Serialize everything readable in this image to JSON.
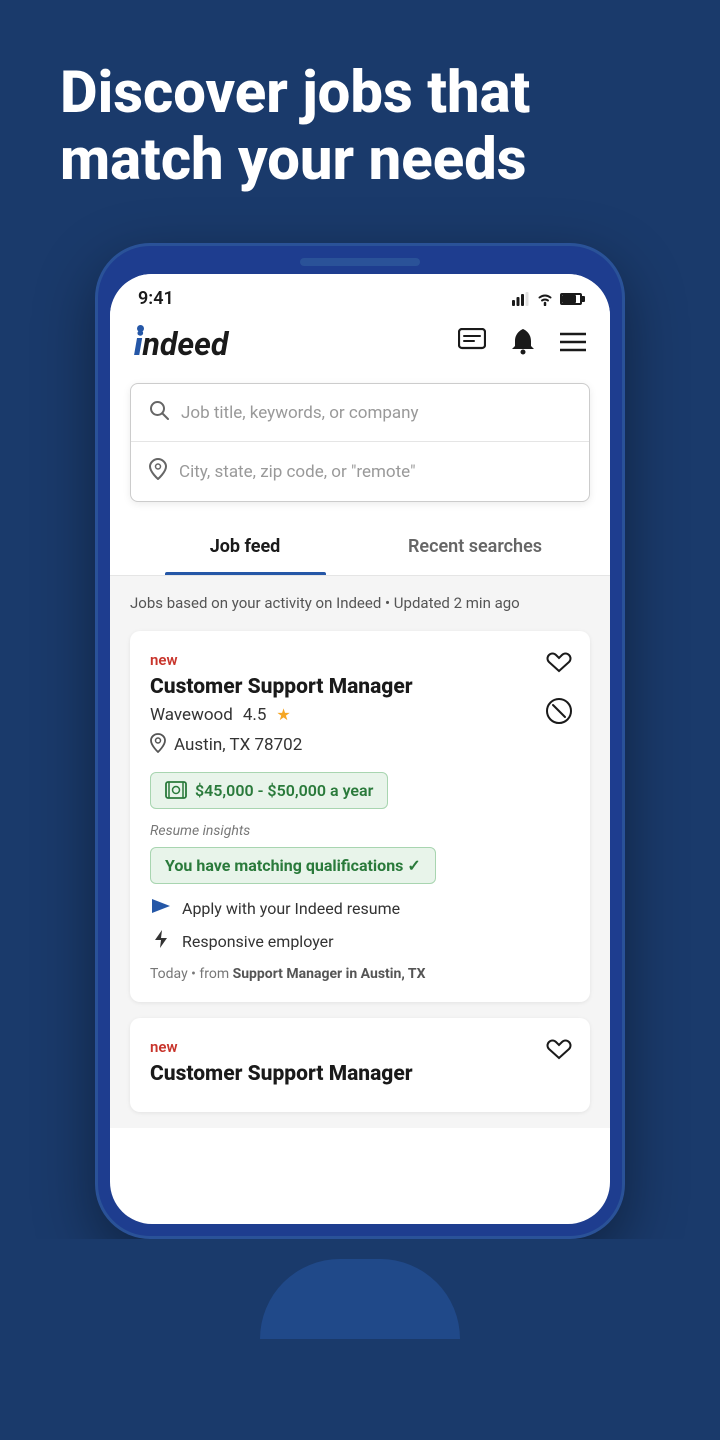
{
  "hero": {
    "title": "Discover jobs that match your needs",
    "background_color": "#1a3a6b"
  },
  "status_bar": {
    "time": "9:41"
  },
  "header": {
    "logo": "indeed",
    "logo_i": "i",
    "logo_rest": "ndeed",
    "messages_icon": "💬",
    "notifications_icon": "🔔",
    "menu_icon": "☰"
  },
  "search": {
    "job_placeholder": "Job title, keywords, or company",
    "location_placeholder": "City, state, zip code, or \"remote\""
  },
  "tabs": [
    {
      "label": "Job feed",
      "active": true
    },
    {
      "label": "Recent searches",
      "active": false
    }
  ],
  "feed": {
    "description": "Jobs based on your activity on Indeed • Updated 2 min ago"
  },
  "job_cards": [
    {
      "badge": "new",
      "title": "Customer Support Manager",
      "company": "Wavewood",
      "rating": "4.5",
      "location": "Austin, TX 78702",
      "salary": "$45,000 - $50,000 a year",
      "resume_insights_label": "Resume insights",
      "matching_text": "You have matching qualifications ✓",
      "apply_text": "Apply with your Indeed resume",
      "responsive_text": "Responsive employer",
      "footer_text": "Today • from",
      "footer_search": "Support Manager in Austin, TX"
    },
    {
      "badge": "new",
      "title": "Customer Support Manager"
    }
  ]
}
